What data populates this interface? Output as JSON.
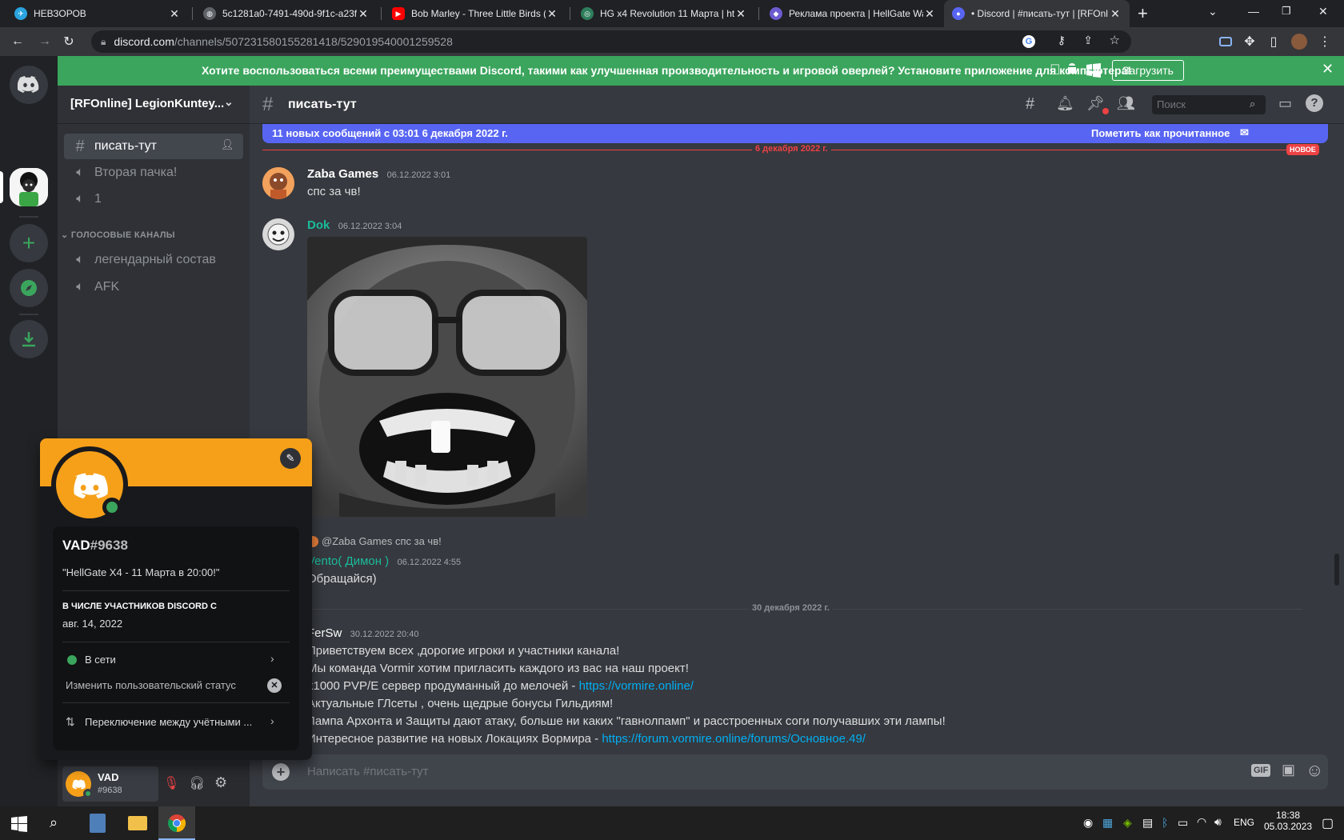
{
  "browser": {
    "tabs": [
      {
        "title": "НЕВЗОРОВ",
        "favicon": "telegram-icon",
        "color": "#2aa3df"
      },
      {
        "title": "5c1281a0-7491-490d-9f1c-a23f",
        "favicon": "globe-icon",
        "color": "#5f6368"
      },
      {
        "title": "Bob Marley - Three Little Birds (",
        "favicon": "youtube-icon",
        "color": "#ff0000"
      },
      {
        "title": "HG x4 Revolution 11 Марта | htt",
        "favicon": "hg-icon",
        "color": "#2e7d5b"
      },
      {
        "title": "Реклама проекта | HellGate Wa",
        "favicon": "hellgate-icon",
        "color": "#6d5bd0"
      },
      {
        "title": "• Discord | #писать-тут | [RFOnl",
        "favicon": "discord-icon",
        "color": "#5865f2"
      }
    ],
    "url_domain": "discord.com",
    "url_path": "/channels/507231580155281418/529019540001259528"
  },
  "banner": {
    "text": "Хотите воспользоваться всеми преимуществами Discord, такими как улучшенная производительность и игровой оверлей? Установите приложение для компьютера!",
    "button": "Загрузить"
  },
  "sidebar": {
    "server_name": "[RFOnline] LegionKuntey...",
    "channels": [
      {
        "name": "писать-тут",
        "icon": "hash-icon",
        "selected": true
      },
      {
        "name": "Вторая пачка!",
        "icon": "speaker-icon"
      },
      {
        "name": "1",
        "icon": "speaker-icon"
      }
    ],
    "category": "ГОЛОСОВЫЕ КАНАЛЫ",
    "voice_channels": [
      {
        "name": "легендарный состав",
        "icon": "speaker-icon"
      },
      {
        "name": "AFK",
        "icon": "speaker-icon"
      }
    ]
  },
  "user": {
    "name": "VAD",
    "tag": "#9638"
  },
  "channel": {
    "name": "писать-тут",
    "search_placeholder": "Поиск",
    "new_messages": "11 новых сообщений с 03:01 6 декабря 2022 г.",
    "mark_read": "Пометить как прочитанное",
    "composer_placeholder": "Написать #писать-тут",
    "gif": "GIF"
  },
  "dividers": {
    "first": "6 декабря 2022 г.",
    "new_badge": "НОВОЕ",
    "second": "30 декабря 2022 г."
  },
  "messages": [
    {
      "author": "Zaba Games",
      "time": "06.12.2022 3:01",
      "text": "спс за чв!",
      "color": "#ffffff"
    },
    {
      "author": "Dok",
      "time": "06.12.2022 3:04",
      "color": "#1abc9c"
    },
    {
      "reply_author": "@Zaba Games",
      "reply_text": "спс за чв!",
      "author": "Vento( Димон )",
      "time": "06.12.2022 4:55",
      "text": "Обращайся)",
      "color": "#1abc9c"
    },
    {
      "author": "FerSw",
      "time": "30.12.2022 20:40",
      "color": "#ffffff",
      "lines": [
        "Приветствуем всех ,дорогие игроки и участники канала!",
        "Мы команда Vormir хотим пригласить каждого из вас на наш проект!",
        "х1000 PVP/E сервер продуманный до мелочей - ",
        "Актуальные ГЛсеты , очень щедрые бонусы Гильдиям!",
        "Лампа Архонта и Защиты дают атаку, больше ни каких \"гавнолпамп\" и расстроенных соги получавших эти лампы!",
        "Интересное развитие на новых Локациях Вормира - "
      ],
      "link1": "https://vormire.online/",
      "link2": "https://forum.vormire.online/forums/Основное.49/"
    }
  ],
  "popout": {
    "name": "VAD",
    "tag": "#9638",
    "status_quote": "\"HellGate X4 - 11 Марта в 20:00!\"",
    "member_since_label": "В ЧИСЛЕ УЧАСТНИКОВ DISCORD С",
    "member_since": "авг. 14, 2022",
    "online": "В сети",
    "custom_status": "Изменить пользовательский статус",
    "switch_accounts": "Переключение между учётными ...",
    "banner_color": "#f6a019"
  },
  "taskbar": {
    "lang": "ENG",
    "time": "18:38",
    "date": "05.03.2023"
  }
}
